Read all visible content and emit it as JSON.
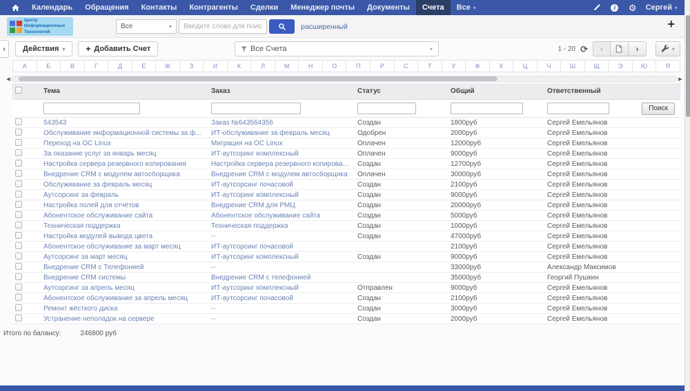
{
  "topnav": {
    "items": [
      {
        "name": "calendar",
        "label": "Календарь"
      },
      {
        "name": "cases",
        "label": "Обращения"
      },
      {
        "name": "contacts",
        "label": "Контакты"
      },
      {
        "name": "counterparties",
        "label": "Контрагенты"
      },
      {
        "name": "deals",
        "label": "Сделки"
      },
      {
        "name": "mail-manager",
        "label": "Менеджер почты"
      },
      {
        "name": "documents",
        "label": "Документы"
      },
      {
        "name": "invoices",
        "label": "Счета"
      },
      {
        "name": "all",
        "label": "Все",
        "caret": true
      }
    ],
    "active": "Счета",
    "user": "Сергей"
  },
  "header": {
    "logo": {
      "line1": "Центр",
      "line2": "Информационных",
      "line3": "Технологий"
    },
    "search_scope": "Все",
    "search_placeholder": "Введите слово для поиска",
    "advanced_label": "расширенный",
    "quick_add": "+"
  },
  "toolbar": {
    "actions_label": "Действия",
    "add_label": "Добавить Счет",
    "add_plus": "+",
    "view_filter": "Все Счета",
    "pagination_range": "1 - 20"
  },
  "alphabet": [
    "А",
    "Б",
    "В",
    "Г",
    "Д",
    "Е",
    "Ж",
    "З",
    "И",
    "К",
    "Л",
    "М",
    "Н",
    "О",
    "П",
    "Р",
    "С",
    "Т",
    "У",
    "Ф",
    "Х",
    "Ц",
    "Ч",
    "Ш",
    "Щ",
    "Э",
    "Ю",
    "Я"
  ],
  "table": {
    "columns": [
      "Тема",
      "Заказ",
      "Статус",
      "Общий",
      "Ответственный"
    ],
    "search_button": "Поиск",
    "rows": [
      {
        "subject": "543543",
        "order": "Заказ №643564356",
        "status": "Создан",
        "total": "1800руб",
        "owner": "Сергей Емельянов"
      },
      {
        "subject": "Обслуживание информационной системы за ф...",
        "order": "ИТ-обслуживание за февраль месяц",
        "status": "Одобрен",
        "total": "2000руб",
        "owner": "Сергей Емельянов"
      },
      {
        "subject": "Переход на ОС Linux",
        "order": "Миграция на ОС Linux",
        "status": "Оплачен",
        "total": "12000руб",
        "owner": "Сергей Емельянов"
      },
      {
        "subject": "За оказание услуг за январь месяц",
        "order": "ИТ-аутсоринг комплексный",
        "status": "Оплачен",
        "total": "9000руб",
        "owner": "Сергей Емельянов"
      },
      {
        "subject": "Настройка сервера резервного копирования",
        "order": "Настройка сервера резервного копирования",
        "status": "Создан",
        "total": "12700руб",
        "owner": "Сергей Емельянов"
      },
      {
        "subject": "Внедрение CRM с модулем автосборщика",
        "order": "Внедрение CRM с модулем автосборщика",
        "status": "Оплачен",
        "total": "30000руб",
        "owner": "Сергей Емельянов"
      },
      {
        "subject": "Обслуживание за февраль месяц",
        "order": "ИТ-аутсорсинг почасовой",
        "status": "Создан",
        "total": "2100руб",
        "owner": "Сергей Емельянов"
      },
      {
        "subject": "Аутсорсинг за февраль",
        "order": "ИТ-аутсоринг комплексный",
        "status": "Создан",
        "total": "9000руб",
        "owner": "Сергей Емельянов"
      },
      {
        "subject": "Настройка полей для отчётов",
        "order": "Внедрение CRM для РМЦ",
        "status": "Создан",
        "total": "20000руб",
        "owner": "Сергей Емельянов"
      },
      {
        "subject": "Абонентское обслуживание сайта",
        "order": "Абонентское обслуживание сайта",
        "status": "Создан",
        "total": "5000руб",
        "owner": "Сергей Емельянов"
      },
      {
        "subject": "Техническая поддержка",
        "order": "Техническая поддержка",
        "status": "Создан",
        "total": "1000руб",
        "owner": "Сергей Емельянов"
      },
      {
        "subject": "Настройка модулей вывода цвета",
        "order": "--",
        "status": "Создан",
        "total": "47000руб",
        "owner": "Сергей Емельянов"
      },
      {
        "subject": "Абонентское обслуживание за март месяц",
        "order": "ИТ-аутсорсинг почасовой",
        "status": "",
        "total": "2100руб",
        "owner": "Сергей Емельянов"
      },
      {
        "subject": "Аутсорсинг за март месяц",
        "order": "ИТ-аутсоринг комплексный",
        "status": "Создан",
        "total": "9000руб",
        "owner": "Сергей Емельянов"
      },
      {
        "subject": "Внедрение CRM с Телефонией",
        "order": "--",
        "status": "",
        "total": "33000руб",
        "owner": "Александр Максимов"
      },
      {
        "subject": "Внедрение CRM системы",
        "order": "Внедрение CRM с телефонией",
        "status": "",
        "total": "35000руб",
        "owner": "Георгий Пушкин"
      },
      {
        "subject": "Аутсорсинг за апрель месяц",
        "order": "ИТ-аутсоринг комплексный",
        "status": "Отправлен",
        "total": "9000руб",
        "owner": "Сергей Емельянов"
      },
      {
        "subject": "Абонентское обслуживание за апрель месяц",
        "order": "ИТ-аутсорсинг почасовой",
        "status": "Создан",
        "total": "2100руб",
        "owner": "Сергей Емельянов"
      },
      {
        "subject": "Ремонт жёсткого диска",
        "order": "--",
        "status": "Создан",
        "total": "3000руб",
        "owner": "Сергей Емельянов"
      },
      {
        "subject": "Устранение неполадок на сервере",
        "order": "--",
        "status": "Создан",
        "total": "2000руб",
        "owner": "Сергей Емельянов"
      }
    ]
  },
  "footer": {
    "total_label": "Итого по балансу:",
    "total_value": "246800 руб"
  },
  "colors": {
    "nav_bg": "#3a57a8",
    "nav_active_bg": "#2b3e66",
    "search_button": "#3a5cc0",
    "logo_bg": "#a6d9f2",
    "link": "#6b83b5"
  }
}
